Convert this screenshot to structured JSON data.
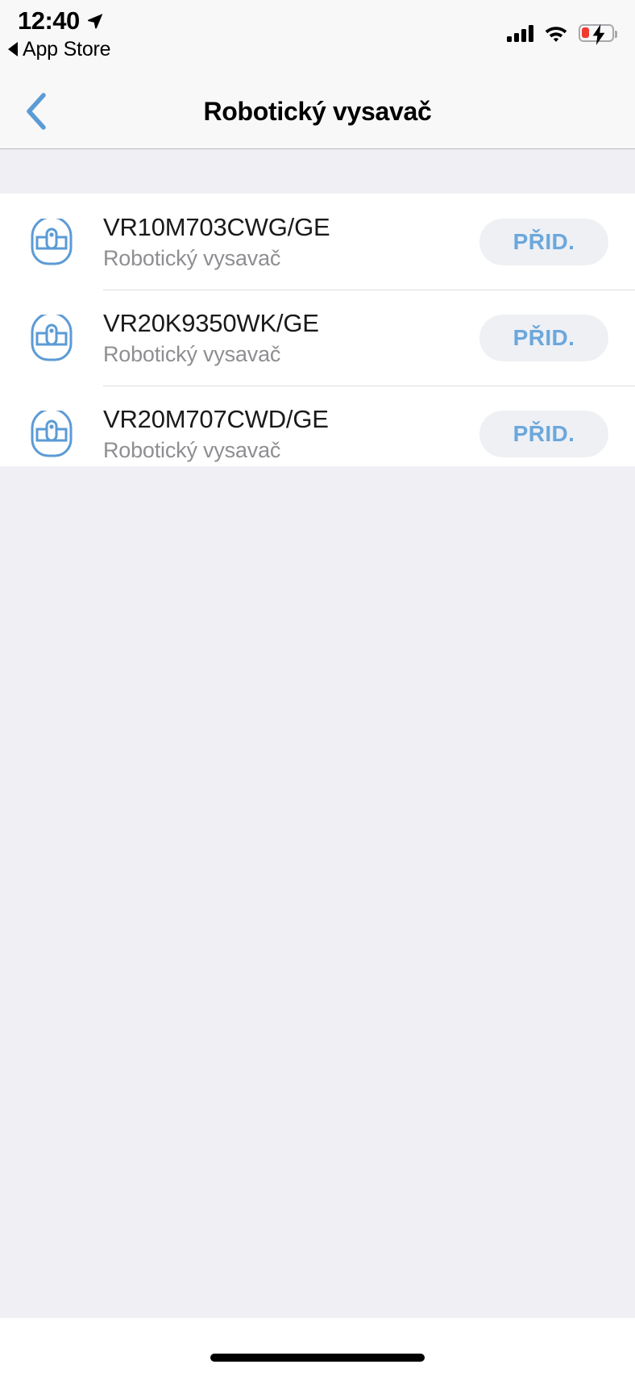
{
  "status_bar": {
    "time": "12:40",
    "location_icon": "location-arrow-icon",
    "back_app_label": "App Store",
    "back_app_arrow_icon": "triangle-left-icon",
    "cellular_icon": "cellular-signal-icon",
    "cellular_bars": 4,
    "wifi_icon": "wifi-icon",
    "battery_icon": "battery-charging-icon",
    "battery_level_percent": 20,
    "battery_charging": true
  },
  "nav_bar": {
    "back_icon": "chevron-left-icon",
    "title": "Robotický vysavač"
  },
  "list": {
    "rows": [
      {
        "icon": "robot-vacuum-icon",
        "title": "VR10M703CWG/GE",
        "subtitle": "Robotický vysavač",
        "action_label": "PŘID."
      },
      {
        "icon": "robot-vacuum-icon",
        "title": "VR20K9350WK/GE",
        "subtitle": "Robotický vysavač",
        "action_label": "PŘID."
      },
      {
        "icon": "robot-vacuum-icon",
        "title": "VR20M707CWD/GE",
        "subtitle": "Robotický vysavač",
        "action_label": "PŘID."
      }
    ]
  },
  "home_indicator": {
    "name": "home-indicator"
  },
  "colors": {
    "accent_blue": "#6ba7dd",
    "nav_back_blue": "#5b9bd5",
    "background_gray": "#f0eff4",
    "bar_gray": "#f8f8f8",
    "button_gray": "#eef0f4",
    "subtitle_gray": "#8e8e93",
    "battery_red": "#f03b30"
  }
}
